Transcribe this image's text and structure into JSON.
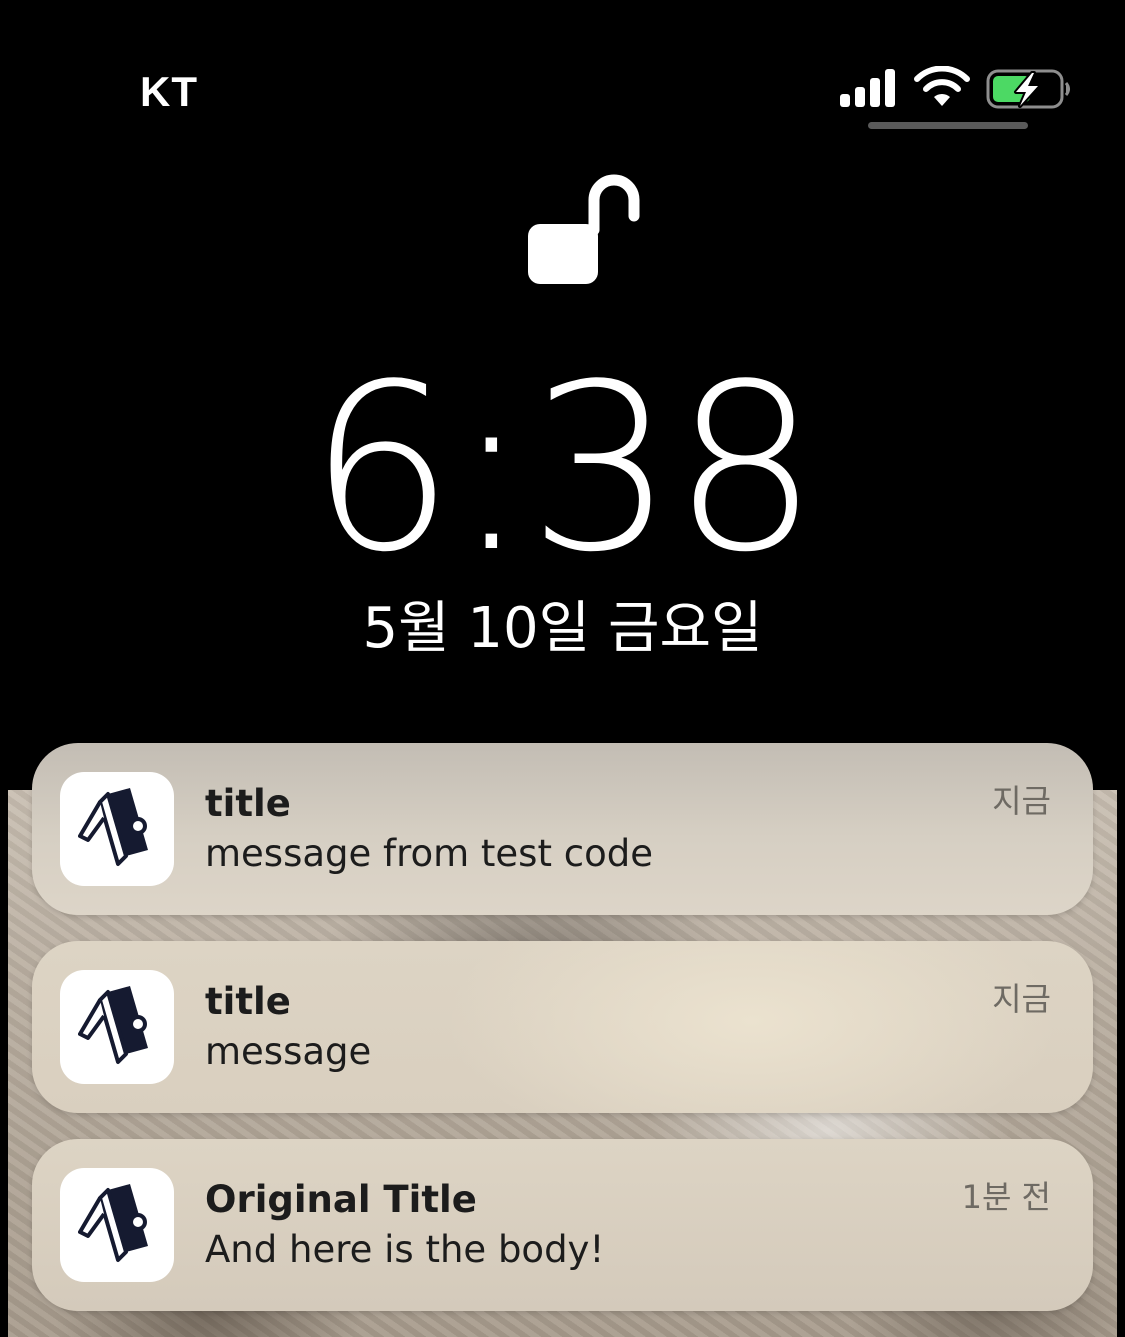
{
  "status_bar": {
    "carrier": "KT",
    "signal_icon": "cellular-signal-icon",
    "wifi_icon": "wifi-icon",
    "battery_icon": "battery-charging-icon",
    "battery_color": "#4cd964"
  },
  "lock": {
    "icon": "unlocked-padlock-icon"
  },
  "clock": {
    "time": "6:38",
    "date": "5월 10일 금요일"
  },
  "notifications": [
    {
      "app_icon": "app-logo-icon",
      "title": "title",
      "body": "message from test code",
      "time": "지금"
    },
    {
      "app_icon": "app-logo-icon",
      "title": "title",
      "body": "message",
      "time": "지금"
    },
    {
      "app_icon": "app-logo-icon",
      "title": "Original Title",
      "body": "And here is the body!",
      "time": "1분 전"
    }
  ]
}
